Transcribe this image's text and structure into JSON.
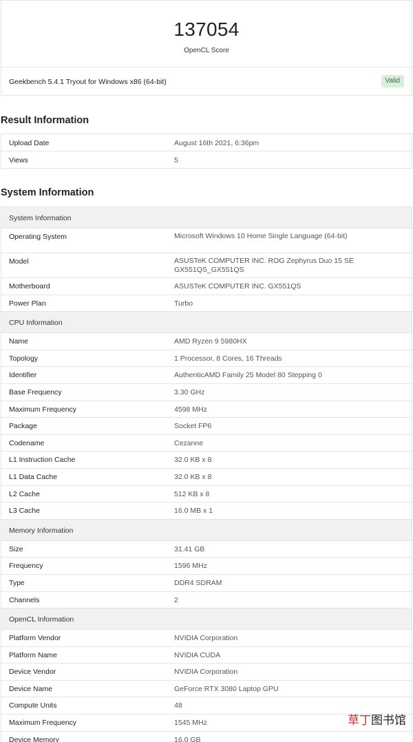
{
  "score": {
    "value": "137054",
    "label": "OpenCL Score",
    "version": "Geekbench 5.4.1 Tryout for Windows x86 (64-bit)",
    "badge": "Valid"
  },
  "result_section": {
    "title": "Result Information",
    "rows": [
      {
        "key": "Upload Date",
        "value": "August 16th 2021, 6:36pm"
      },
      {
        "key": "Views",
        "value": "5"
      }
    ]
  },
  "system_section": {
    "title": "System Information",
    "groups": [
      {
        "header": "System Information",
        "rows": [
          {
            "key": "Operating System",
            "value": "Microsoft Windows 10 Home Single Language (64-bit)"
          },
          {
            "key": "Model",
            "value": "ASUSTeK COMPUTER INC. ROG Zephyrus Duo 15 SE GX551QS_GX551QS"
          },
          {
            "key": "Motherboard",
            "value": "ASUSTeK COMPUTER INC. GX551QS"
          },
          {
            "key": "Power Plan",
            "value": "Turbo"
          }
        ]
      },
      {
        "header": "CPU Information",
        "rows": [
          {
            "key": "Name",
            "value": "AMD Ryzen 9 5980HX"
          },
          {
            "key": "Topology",
            "value": "1 Processor, 8 Cores, 16 Threads"
          },
          {
            "key": "Identifier",
            "value": "AuthenticAMD Family 25 Model 80 Stepping 0"
          },
          {
            "key": "Base Frequency",
            "value": "3.30 GHz"
          },
          {
            "key": "Maximum Frequency",
            "value": "4598 MHz"
          },
          {
            "key": "Package",
            "value": "Socket FP6"
          },
          {
            "key": "Codename",
            "value": "Cezanne"
          },
          {
            "key": "L1 Instruction Cache",
            "value": "32.0 KB x 8"
          },
          {
            "key": "L1 Data Cache",
            "value": "32.0 KB x 8"
          },
          {
            "key": "L2 Cache",
            "value": "512 KB x 8"
          },
          {
            "key": "L3 Cache",
            "value": "16.0 MB x 1"
          }
        ]
      },
      {
        "header": "Memory Information",
        "rows": [
          {
            "key": "Size",
            "value": "31.41 GB"
          },
          {
            "key": "Frequency",
            "value": "1596 MHz"
          },
          {
            "key": "Type",
            "value": "DDR4 SDRAM"
          },
          {
            "key": "Channels",
            "value": "2"
          }
        ]
      },
      {
        "header": "OpenCL Information",
        "rows": [
          {
            "key": "Platform Vendor",
            "value": "NVIDIA Corporation"
          },
          {
            "key": "Platform Name",
            "value": "NVIDIA CUDA"
          },
          {
            "key": "Device Vendor",
            "value": "NVIDIA Corporation"
          },
          {
            "key": "Device Name",
            "value": "GeForce RTX 3080 Laptop GPU"
          },
          {
            "key": "Compute Units",
            "value": "48"
          },
          {
            "key": "Maximum Frequency",
            "value": "1545 MHz"
          },
          {
            "key": "Device Memory",
            "value": "16.0 GB"
          }
        ]
      }
    ]
  },
  "watermark": {
    "text_red": "草丁",
    "text_dark": "图书馆"
  },
  "colors": {
    "badge_bg": "#d9efdc",
    "badge_text": "#2f6b3a",
    "group_header_bg": "#f1f1f1",
    "border": "#e3e3e3"
  }
}
